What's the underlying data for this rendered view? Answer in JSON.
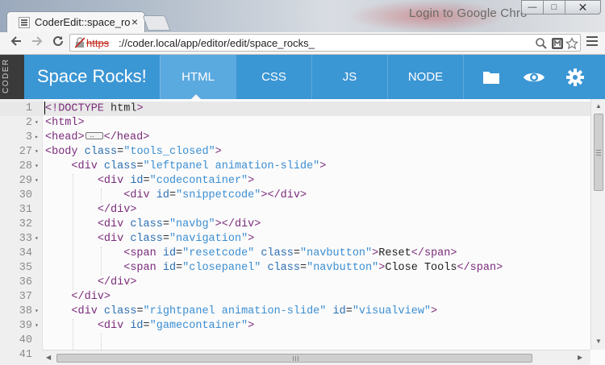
{
  "browser": {
    "tab_title": "CoderEdit::space_rock",
    "tab_close": "×",
    "profile_text": "Login to Google Chro",
    "window_controls": {
      "minimize": "—",
      "maximize": "□",
      "close": "✕"
    },
    "url_scheme": "https",
    "url_rest": "://coder.local/app/editor/edit/space_rocks_"
  },
  "app": {
    "side_label": "CODER",
    "title": "Space Rocks!",
    "tabs": [
      {
        "label": "HTML",
        "active": true
      },
      {
        "label": "CSS",
        "active": false
      },
      {
        "label": "JS",
        "active": false
      },
      {
        "label": "NODE",
        "active": false
      }
    ],
    "icons": [
      "folder-icon",
      "eye-icon",
      "gear-icon"
    ],
    "colors": {
      "navbar": "#3b96d4",
      "active_tab": "#5aa9df",
      "side_strip": "#3a3a3a"
    }
  },
  "editor": {
    "lines": [
      {
        "n": "1",
        "fold": "",
        "code": "<!DOCTYPE html>"
      },
      {
        "n": "2",
        "fold": "▾",
        "code": "<html>"
      },
      {
        "n": "3",
        "fold": "▸",
        "code": "<head>…</head>"
      },
      {
        "n": "27",
        "fold": "▾",
        "code": "<body class=\"tools_closed\">"
      },
      {
        "n": "28",
        "fold": "▾",
        "code": "    <div class=\"leftpanel animation-slide\">"
      },
      {
        "n": "29",
        "fold": "▾",
        "code": "        <div id=\"codecontainer\">"
      },
      {
        "n": "30",
        "fold": "",
        "code": "            <div id=\"snippetcode\"></div>"
      },
      {
        "n": "31",
        "fold": "",
        "code": "        </div>"
      },
      {
        "n": "32",
        "fold": "",
        "code": "        <div class=\"navbg\"></div>"
      },
      {
        "n": "33",
        "fold": "▾",
        "code": "        <div class=\"navigation\">"
      },
      {
        "n": "34",
        "fold": "",
        "code": "            <span id=\"resetcode\" class=\"navbutton\">Reset</span>"
      },
      {
        "n": "35",
        "fold": "",
        "code": "            <span id=\"closepanel\" class=\"navbutton\">Close Tools</span>"
      },
      {
        "n": "36",
        "fold": "",
        "code": "        </div>"
      },
      {
        "n": "37",
        "fold": "",
        "code": "    </div>"
      },
      {
        "n": "38",
        "fold": "▾",
        "code": "    <div class=\"rightpanel animation-slide\" id=\"visualview\">"
      },
      {
        "n": "39",
        "fold": "▾",
        "code": "        <div id=\"gamecontainer\">"
      },
      {
        "n": "40",
        "fold": "",
        "code": ""
      },
      {
        "n": "41",
        "fold": "",
        "code": ""
      }
    ]
  }
}
